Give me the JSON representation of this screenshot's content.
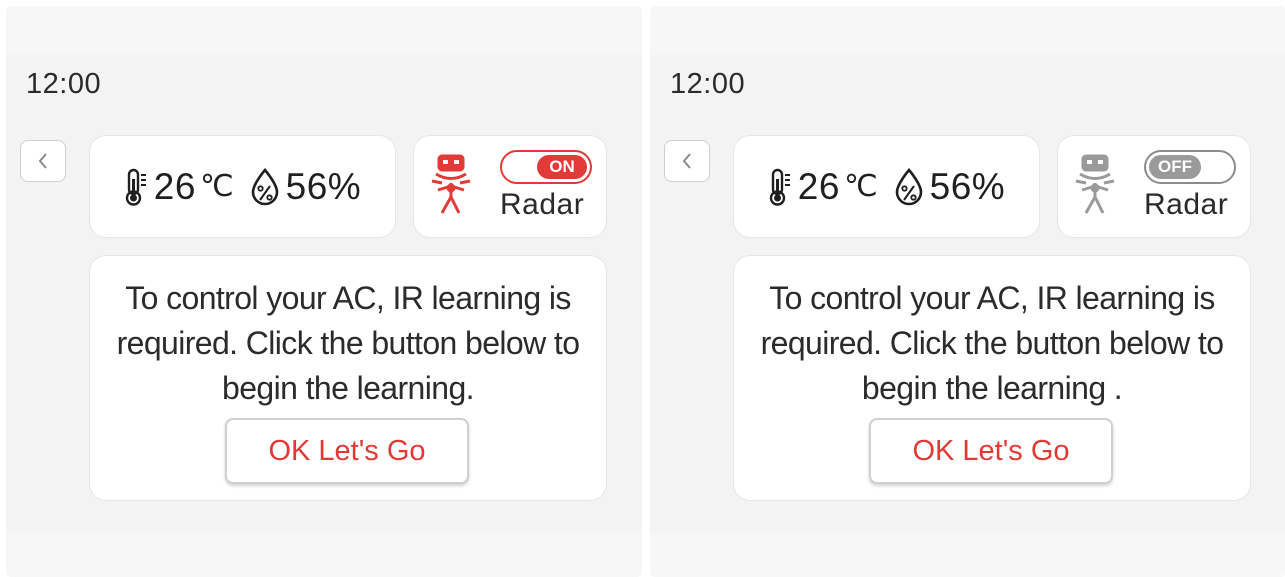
{
  "colors": {
    "accent": "#e23a36",
    "off_gray": "#9a9a9a",
    "text": "#2b2b2b"
  },
  "screens": [
    {
      "clock": "12:00",
      "temperature": "26",
      "temperature_unit": "℃",
      "humidity": "56%",
      "radar": {
        "state": "ON",
        "label": "Radar"
      },
      "message": "To control your AC, IR learning is required. Click the button below to begin the learning.",
      "button_label": "OK Let's Go"
    },
    {
      "clock": "12:00",
      "temperature": "26",
      "temperature_unit": "℃",
      "humidity": "56%",
      "radar": {
        "state": "OFF",
        "label": "Radar"
      },
      "message": "To control your AC,  IR learning is required. Click the button below to begin the learning .",
      "button_label": "OK Let's Go"
    }
  ],
  "icons": [
    "back-chevron-icon",
    "thermometer-icon",
    "humidity-drop-icon",
    "radar-sensor-icon"
  ]
}
